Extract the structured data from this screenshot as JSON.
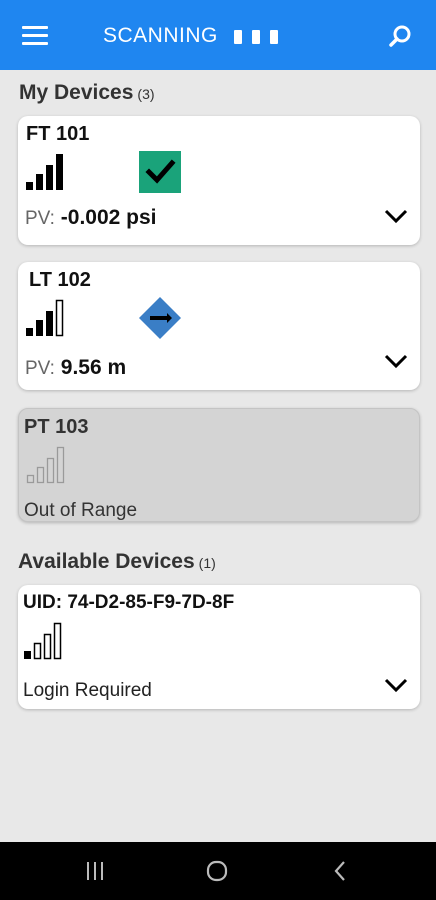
{
  "appbar": {
    "title": "SCANNING",
    "menu_icon": "hamburger-menu-icon",
    "search_icon": "search-icon",
    "color": "#1f86f0"
  },
  "my_devices": {
    "title": "My Devices",
    "count": "(3)",
    "devices": [
      {
        "tag": "FT 101",
        "pv_label": "PV:",
        "pv_value": "-0.002 psi",
        "signal_bars": 4,
        "status_icon": "checkmark-icon",
        "status_color": "#1aa37a"
      },
      {
        "tag": "LT 102",
        "pv_label": "PV:",
        "pv_value": "9.56 m",
        "signal_bars": 3,
        "status_icon": "diamond-device-icon",
        "status_color": "#3a7ec6"
      },
      {
        "tag": "PT 103",
        "status": "Out of Range",
        "signal_bars": 0
      }
    ]
  },
  "available_devices": {
    "title": "Available Devices",
    "count": "(1)",
    "devices": [
      {
        "uid_label": "UID:",
        "uid": "74-D2-85-F9-7D-8F",
        "status": "Login Required",
        "signal_bars": 1
      }
    ]
  },
  "navbar": {
    "recent_icon": "recent-apps-icon",
    "home_icon": "home-icon",
    "back_icon": "back-icon"
  }
}
